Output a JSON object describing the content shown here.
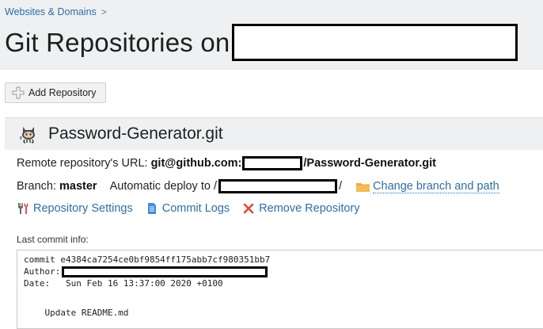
{
  "breadcrumb": {
    "item": "Websites & Domains",
    "separator": ">"
  },
  "page": {
    "title_prefix": "Git Repositories on"
  },
  "toolbar": {
    "add_repository": "Add Repository"
  },
  "repo": {
    "name": "Password-Generator.git",
    "remote_label": "Remote repository's URL:",
    "remote_prefix": "git@github.com:",
    "remote_suffix": "/Password-Generator.git",
    "branch_label": "Branch:",
    "branch_value": "master",
    "deploy_label": "Automatic deploy to",
    "deploy_prefix": "/",
    "deploy_suffix": "/",
    "change_branch": "Change branch and path",
    "actions": {
      "settings": "Repository Settings",
      "commit_logs": "Commit Logs",
      "remove": "Remove Repository"
    },
    "last_commit_label": "Last commit info:",
    "commit": {
      "hash_line": "commit e4384ca7254ce0bf9854ff175abb7cf980351bb7",
      "author_label": "Author:",
      "date_line": "Date:   Sun Feb 16 13:37:00 2020 +0100",
      "message": "    Update README.md"
    }
  },
  "colors": {
    "link": "#2f6ea4",
    "header_bg": "#eef0f1",
    "remove_icon": "#e0483a",
    "folder_icon": "#f0a83a"
  }
}
